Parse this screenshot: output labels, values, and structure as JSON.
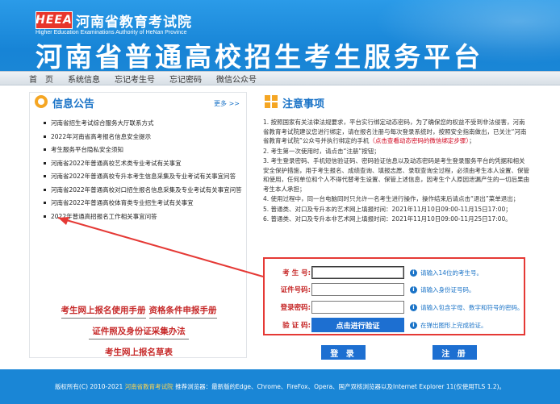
{
  "header": {
    "logo_text": "HEEA",
    "org_cn": "河南省教育考试院",
    "org_en": "Higher Education Examinations Authority of HeNan Province",
    "site_title": "河南省普通高校招生考生服务平台"
  },
  "nav": {
    "items": [
      "首　页",
      "系统信息",
      "忘记考生号",
      "忘记密码",
      "微信公众号"
    ]
  },
  "news": {
    "title": "信息公告",
    "more": "更多 >>",
    "items": [
      "河南省招生考试综合服务大厅联系方式",
      "2022年河南省高考报名信息安全提示",
      "考生服务平台隐私安全须知",
      "河南省2022年普通高校艺术类专业考试有关事宜",
      "河南省2022年普通高校专升本考生信息采集及专业考试有关事宜问答",
      "河南省2022年普通高校对口招生报名信息采集及专业考试有关事宜问答",
      "河南省2022年普通高校体育类专业招生考试有关事宜",
      "2022年普通高招报名工作相关事宜问答"
    ]
  },
  "links": {
    "manual": "考生网上报名使用手册",
    "qualification": "资格条件申报手册",
    "photo": "证件照及身份证采集办法",
    "form": "考生网上报名草表"
  },
  "notices": {
    "title": "注意事项",
    "items": [
      {
        "text": "1. 按照国家有关法律法规要求，平台实行绑定动态密码，为了确保您的权益不受到非法侵害，河南省教育考试院建议您进行绑定，请在报名注册与每次登录系统时，按照安全指南做出，已关注“河南省教育考试院”公众号并执行绑定的手机",
        "highlight": "（点击查看动态密码的微信绑定步骤）",
        "tail": "；"
      },
      {
        "text": "2. 考生第一次使用时，请点击“注册”按钮；",
        "highlight": "",
        "tail": ""
      },
      {
        "text": "3. 考生登录密码、手机短信验证码、密码验证信息以及动态密码是考生登录服务平台的凭据和相关安全保护措施，用于考生报名、成绩查询、填报志愿、录取查询全过程，必须由考生本人设置、保管和使用，任何单位和个人不得代替考生设置、保管上述信息，因考生个人原因泄漏产生的一切后果由考生本人承担；",
        "highlight": "",
        "tail": ""
      },
      {
        "text": "4. 使用过程中，同一台电脑同时只允许一名考生进行操作，操作结束后请点击“退出”菜单退出；",
        "highlight": "",
        "tail": ""
      },
      {
        "text": "5. 普通类、对口及专升本的艺术网上填报时间：2021年11月10日09:00-11月15日17:00；",
        "highlight": "",
        "tail": ""
      },
      {
        "text": "6. 普通类、对口及专升本非艺术网上填报时间：2021年11月10日09:00-11月25日17:00。",
        "highlight": "",
        "tail": ""
      }
    ]
  },
  "form": {
    "exam_no_label": "考 生 号:",
    "exam_no_value": "",
    "exam_no_hint": "请输入14位的考生号。",
    "id_label": "证件号码:",
    "id_value": "",
    "id_hint": "请输入身份证号码。",
    "password_label": "登录密码:",
    "password_value": "",
    "password_hint": "请输入包含字母、数字和符号的密码。",
    "verify_label": "验 证 码:",
    "verify_button": "点击进行验证",
    "verify_hint": "在弹出图形上完成验证。",
    "login_button": "登 录",
    "register_button": "注 册",
    "info_glyph": "i"
  },
  "footer": {
    "prefix": "版权所有(C) 2010-2021 ",
    "org_link": "河南省教育考试院",
    "suffix": "  推荐浏览器：最新版的Edge、Chrome、FireFox、Opera、国产双核浏览器以及Internet Explorer 11(仅使用TLS 1.2)。"
  },
  "colors": {
    "header_blue": "#1a86d6",
    "accent_red": "#e53935",
    "button_blue": "#1d6fd1",
    "icon_orange": "#f5a623"
  }
}
